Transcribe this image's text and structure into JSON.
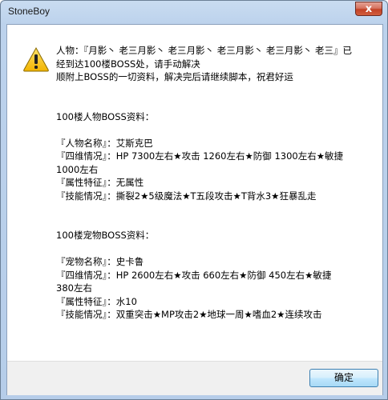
{
  "window": {
    "title": "StoneBoy",
    "close_label": "x"
  },
  "dialog": {
    "icon": "warning-icon",
    "message_lines": [
      "人物：『月影丶 老三月影丶 老三月影丶 老三月影丶 老三月影丶 老三』已",
      "经到达100楼BOSS处，请手动解决",
      "顺附上BOSS的一切资料，解决完后请继续脚本，祝君好运",
      "",
      "",
      "100楼人物BOSS资料：",
      "",
      "『人物名称』：艾斯克巴",
      "『四维情况』：HP 7300左右★攻击 1260左右★防御 1300左右★敏捷",
      "1000左右",
      "『属性特征』：无属性",
      "『技能情况』：撕裂2★5级魔法★T五段攻击★T背水3★狂暴乱走",
      "",
      "",
      "100楼宠物BOSS资料：",
      "",
      "『宠物名称』：史卡鲁",
      "『四维情况』：HP 2600左右★攻击 660左右★防御 450左右★敏捷",
      "380左右",
      "『属性特征』：水10",
      "『技能情况』：双重突击★MP攻击2★地球一周★嗜血2★连续攻击"
    ],
    "ok_label": "确定"
  }
}
